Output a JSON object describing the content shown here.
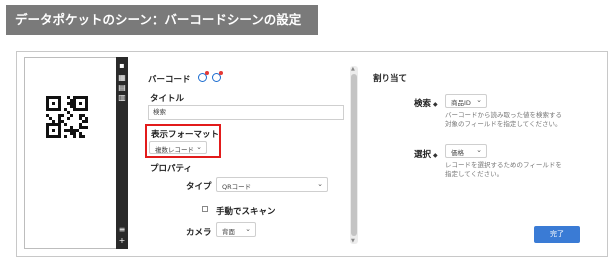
{
  "banner": {
    "title": "データポケットのシーン：バーコードシーンの設定"
  },
  "middle": {
    "section_title": "バーコード",
    "title_label": "タイトル",
    "title_value": "検索",
    "display_format_label": "表示フォーマット",
    "display_format_value": "複数レコード",
    "properties_label": "プロパティ",
    "type_label": "タイプ",
    "type_value": "QRコード",
    "manual_scan_label": "手動でスキャン",
    "camera_label": "カメラ",
    "camera_value": "背面"
  },
  "right": {
    "section_title": "割り当て",
    "search_label": "検索",
    "required_mark": "◆",
    "search_value": "商品ID",
    "search_hint_1": "バーコードから読み取った値を検索する",
    "search_hint_2": "対象のフィールドを指定してください。",
    "select_label": "選択",
    "select_value": "価格",
    "select_hint_1": "レコードを選択するためのフィールドを",
    "select_hint_2": "指定してください。"
  },
  "footer": {
    "done_label": "完了"
  },
  "preview": {
    "strip_menu_icon": "≡",
    "strip_add_icon": "+"
  }
}
